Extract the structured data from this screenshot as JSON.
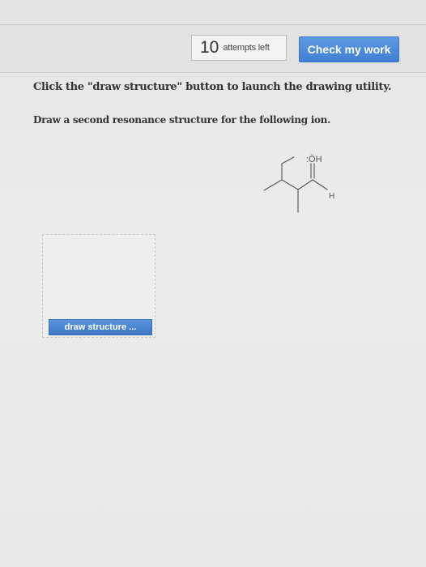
{
  "header": {
    "attempts_count": "10",
    "attempts_label": "attempts left",
    "check_button_label": "Check my work"
  },
  "question": {
    "instruction_1": "Click the \"draw structure\" button to launch the drawing utility.",
    "instruction_2": "Draw a second resonance structure for the following ion."
  },
  "molecule": {
    "oh_label": ":ÖH",
    "h_label": "H"
  },
  "answer": {
    "draw_button_label": "draw structure ..."
  },
  "colors": {
    "accent": "#4a86d6",
    "background": "#e8e8e6"
  }
}
